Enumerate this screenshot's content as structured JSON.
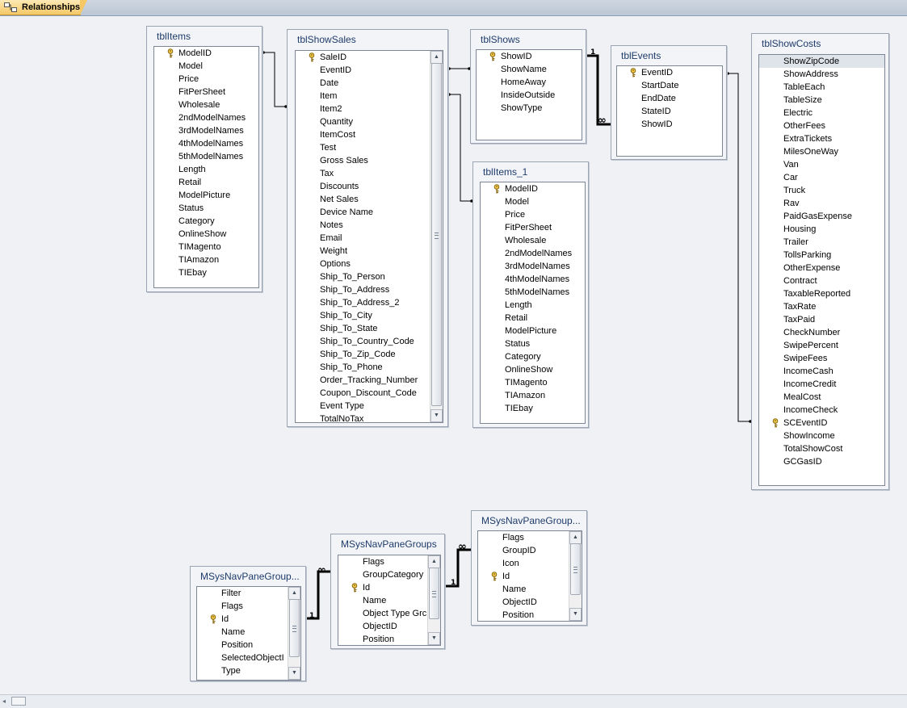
{
  "tab": {
    "label": "Relationships",
    "icon": "relationships-icon"
  },
  "tables": {
    "tblItems": {
      "title": "tblItems",
      "fields": [
        "ModelID",
        "Model",
        "Price",
        "FitPerSheet",
        "Wholesale",
        "2ndModelNames",
        "3rdModelNames",
        "4thModelNames",
        "5thModelNames",
        "Length",
        "Retail",
        "ModelPicture",
        "Status",
        "Category",
        "OnlineShow",
        "TIMagento",
        "TIAmazon",
        "TIEbay"
      ],
      "key_fields": [
        "ModelID"
      ]
    },
    "tblShowSales": {
      "title": "tblShowSales",
      "fields": [
        "SaleID",
        "EventID",
        "Date",
        "Item",
        "Item2",
        "Quantity",
        "ItemCost",
        "Test",
        "Gross Sales",
        "Tax",
        "Discounts",
        "Net Sales",
        "Device Name",
        "Notes",
        "Email",
        "Weight",
        "Options",
        "Ship_To_Person",
        "Ship_To_Address",
        "Ship_To_Address_2",
        "Ship_To_City",
        "Ship_To_State",
        "Ship_To_Country_Code",
        "Ship_To_Zip_Code",
        "Ship_To_Phone",
        "Order_Tracking_Number",
        "Coupon_Discount_Code",
        "Event Type",
        "TotalNoTax"
      ],
      "key_fields": [
        "SaleID"
      ]
    },
    "tblShows": {
      "title": "tblShows",
      "fields": [
        "ShowID",
        "ShowName",
        "HomeAway",
        "InsideOutside",
        "ShowType"
      ],
      "key_fields": [
        "ShowID"
      ]
    },
    "tblEvents": {
      "title": "tblEvents",
      "fields": [
        "EventID",
        "StartDate",
        "EndDate",
        "StateID",
        "ShowID"
      ],
      "key_fields": [
        "EventID"
      ]
    },
    "tblItems_1": {
      "title": "tblItems_1",
      "fields": [
        "ModelID",
        "Model",
        "Price",
        "FitPerSheet",
        "Wholesale",
        "2ndModelNames",
        "3rdModelNames",
        "4thModelNames",
        "5thModelNames",
        "Length",
        "Retail",
        "ModelPicture",
        "Status",
        "Category",
        "OnlineShow",
        "TIMagento",
        "TIAmazon",
        "TIEbay"
      ],
      "key_fields": [
        "ModelID"
      ]
    },
    "tblShowCosts": {
      "title": "tblShowCosts",
      "fields": [
        "ShowZipCode",
        "ShowAddress",
        "TableEach",
        "TableSize",
        "Electric",
        "OtherFees",
        "ExtraTickets",
        "MilesOneWay",
        "Van",
        "Car",
        "Truck",
        "Rav",
        "PaidGasExpense",
        "Housing",
        "Trailer",
        "TollsParking",
        "OtherExpense",
        "Contract",
        "TaxableReported",
        "TaxRate",
        "TaxPaid",
        "CheckNumber",
        "SwipePercent",
        "SwipeFees",
        "IncomeCash",
        "IncomeCredit",
        "MealCost",
        "IncomeCheck",
        "SCEventID",
        "ShowIncome",
        "TotalShowCost",
        "GCGasID"
      ],
      "key_fields": [
        "SCEventID"
      ],
      "selected_field": "ShowZipCode"
    },
    "navGroupsLeft": {
      "title": "MSysNavPaneGroup...",
      "fields": [
        "Filter",
        "Flags",
        "Id",
        "Name",
        "Position",
        "SelectedObjectI",
        "Type"
      ],
      "key_fields": [
        "Id"
      ]
    },
    "navGroups": {
      "title": "MSysNavPaneGroups",
      "fields": [
        "Flags",
        "GroupCategory",
        "Id",
        "Name",
        "Object Type Grc",
        "ObjectID",
        "Position"
      ],
      "key_fields": [
        "Id"
      ]
    },
    "navGroupsRight": {
      "title": "MSysNavPaneGroup...",
      "fields": [
        "Flags",
        "GroupID",
        "Icon",
        "Id",
        "Name",
        "ObjectID",
        "Position"
      ],
      "key_fields": [
        "Id"
      ]
    }
  },
  "cardinality": {
    "one": "1",
    "many": "∞"
  },
  "colors": {
    "canvas": "#eff1f4",
    "title_text": "#1e3b6a",
    "tab": "#f5c865"
  }
}
